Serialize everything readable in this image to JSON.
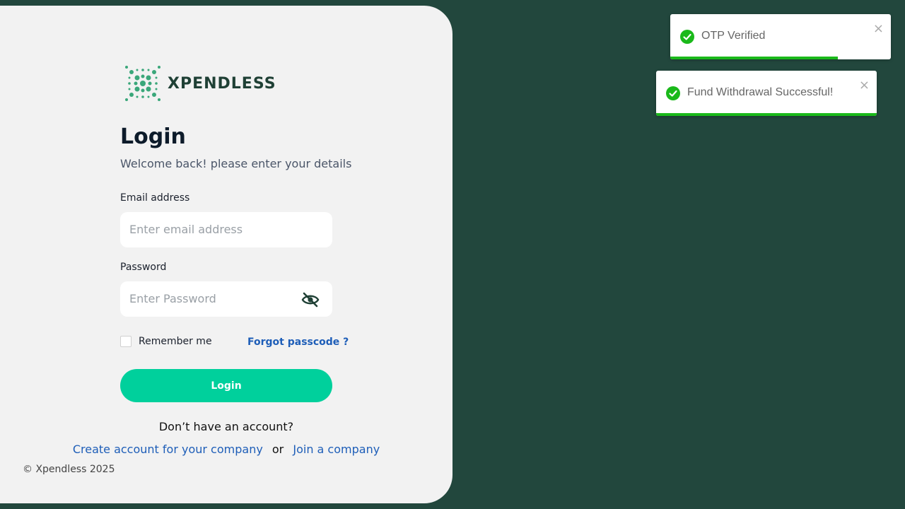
{
  "brand": {
    "name": "XPENDLESS",
    "logo_icon": "xpendless-dots-x-icon"
  },
  "login": {
    "title": "Login",
    "subtitle": "Welcome back! please enter your details",
    "email_label": "Email address",
    "email_placeholder": "Enter email address",
    "email_value": "",
    "password_label": "Password",
    "password_placeholder": "Enter Password",
    "password_value": "",
    "remember_label": "Remember me",
    "remember_checked": false,
    "forgot_label": "Forgot passcode ?",
    "login_button": "Login",
    "no_account_text": "Don’t have an account?",
    "create_link": "Create account for your company",
    "or_text": "or",
    "join_link": "Join a company"
  },
  "footer": {
    "copyright": "© Xpendless 2025"
  },
  "toasts": [
    {
      "message": "OTP Verified",
      "icon": "check-circle-icon",
      "close_icon": "close-icon",
      "progress": 0.76
    },
    {
      "message": "Fund Withdrawal Successful!",
      "icon": "check-circle-icon",
      "close_icon": "close-icon",
      "progress": 1.0
    }
  ],
  "colors": {
    "background": "#22473d",
    "panel": "#f2f2f2",
    "accent": "#00d09c",
    "link": "#1e5eb8",
    "success": "#1ab91a"
  }
}
